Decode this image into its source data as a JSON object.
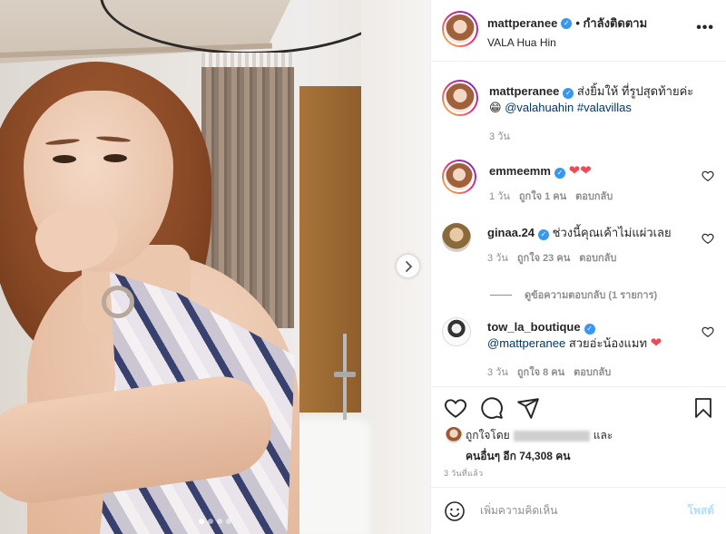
{
  "post": {
    "username": "mattperanee",
    "follow_status": "• กำลังติดตาม",
    "location": "VALA Hua Hin",
    "more_label": "•••"
  },
  "caption": {
    "username": "mattperanee",
    "text": " ส่งยิ้มให้ ที่รูปสุดท้ายค่ะ",
    "emoji": "😁",
    "mention": "@valahuahin",
    "hashtag": "#valavillas",
    "age": "3 วัน"
  },
  "comments": [
    {
      "username": "emmeemm",
      "text": "",
      "hearts": 2,
      "age": "1 วัน",
      "likes": "ถูกใจ 1 คน",
      "reply": "ตอบกลับ"
    },
    {
      "username": "ginaa.24",
      "text": "ช่วงนี้คุณเค้าไม่แผ่วเลย",
      "age": "3 วัน",
      "likes": "ถูกใจ 23 คน",
      "reply": "ตอบกลับ"
    },
    {
      "username": "tow_la_boutique",
      "mention": "@mattperanee",
      "text": " สวยอ่ะน้องแมท",
      "hearts": 1,
      "age": "3 วัน",
      "likes": "ถูกใจ 8 คน",
      "reply": "ตอบกลับ"
    }
  ],
  "view_replies": "ดูข้อความตอบกลับ (1 รายการ)",
  "likes": {
    "prefix": "ถูกใจโดย",
    "suffix": "และ",
    "others": "คนอื่นๆ อีก 74,308 คน"
  },
  "timestamp": "3 วันที่แล้ว",
  "add_comment": {
    "placeholder": "เพิ่มความคิดเห็น",
    "post_label": "โพสต์"
  },
  "icons": [
    "heart-icon",
    "comment-icon",
    "share-icon",
    "bookmark-icon",
    "emoji-icon",
    "chevron-right-icon",
    "verified-icon",
    "more-icon"
  ],
  "colors": {
    "verified": "#3897f0",
    "heart": "#ed4956",
    "link": "#00376b",
    "post_disabled": "#b2dffc",
    "muted": "#8e8e8e"
  },
  "carousel": {
    "slides": 4,
    "active": 0
  }
}
